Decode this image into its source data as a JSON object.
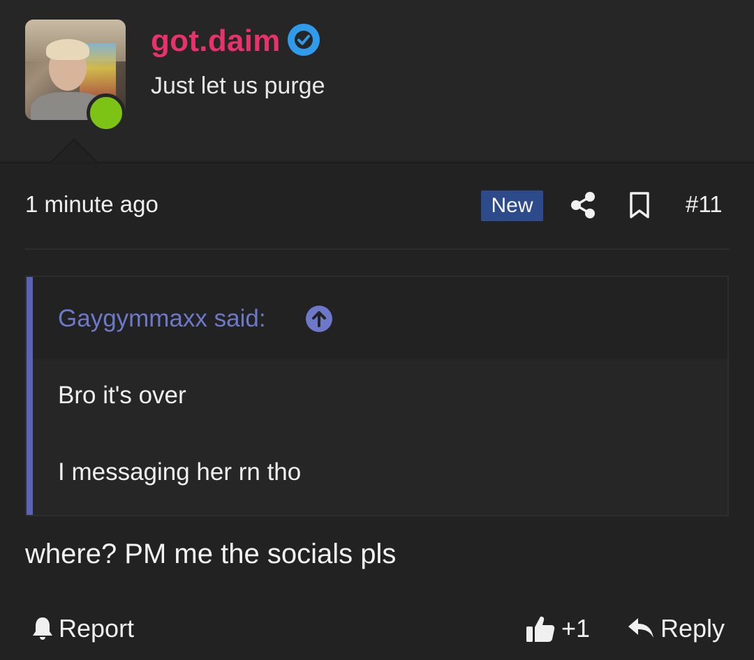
{
  "user": {
    "name": "got.daim",
    "title": "Just let us purge",
    "online": true,
    "name_color": "#e8326b",
    "verified_color": "#2f9bea",
    "online_color": "#7cc316"
  },
  "post": {
    "time": "1 minute ago",
    "badge": "New",
    "number": "#11",
    "body": "where? PM me the socials pls"
  },
  "quote": {
    "author": "Gaygymmaxx said:",
    "lines": [
      "Bro it's over",
      "I messaging her rn tho"
    ],
    "accent_color": "#5a63b8"
  },
  "actions": {
    "report": "Report",
    "likes": "+1",
    "reply": "Reply"
  },
  "icons": [
    "verified-icon",
    "share-icon",
    "bookmark-icon",
    "quote-jump-arrow-icon",
    "bell-icon",
    "thumbs-up-icon",
    "reply-icon"
  ]
}
